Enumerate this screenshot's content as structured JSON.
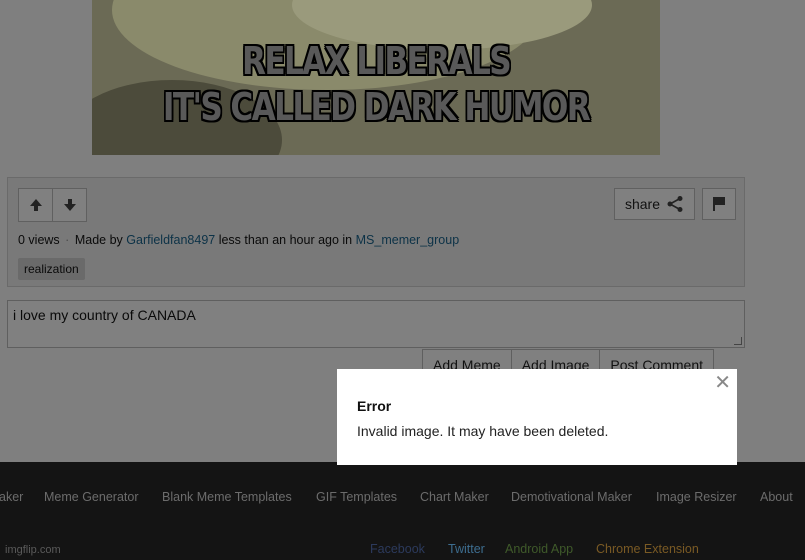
{
  "meme": {
    "caption_lines": [
      "RELAX LIBERALS",
      "IT'S CALLED DARK HUMOR"
    ]
  },
  "post": {
    "upvote_icon": "arrow-up-icon",
    "downvote_icon": "arrow-down-icon",
    "share_label": "share",
    "share_icon": "share-icon",
    "flag_icon": "flag-icon",
    "views": "0 views",
    "made_by_prefix": "Made by",
    "author": "Garfieldfan8497",
    "time_text": "less than an hour ago in",
    "stream": "MS_memer_group",
    "tag": "realization"
  },
  "comment": {
    "value": "i love my country of CANADA",
    "buttons": [
      "Add Meme",
      "Add Image",
      "Post Comment"
    ]
  },
  "footer": {
    "links": [
      "aker",
      "Meme Generator",
      "Blank Meme Templates",
      "GIF Templates",
      "Chart Maker",
      "Demotivational Maker",
      "Image Resizer",
      "About"
    ],
    "logo": "imgflip.com",
    "social": [
      {
        "label": "Facebook",
        "color": "#2c3a5c"
      },
      {
        "label": "Twitter",
        "color": "#3d6d8f"
      },
      {
        "label": "Android App",
        "color": "#3f5a2a"
      },
      {
        "label": "Chrome Extension",
        "color": "#7a5a24"
      }
    ]
  },
  "modal": {
    "close_icon": "close-icon",
    "title": "Error",
    "message": "Invalid image. It may have been deleted."
  }
}
